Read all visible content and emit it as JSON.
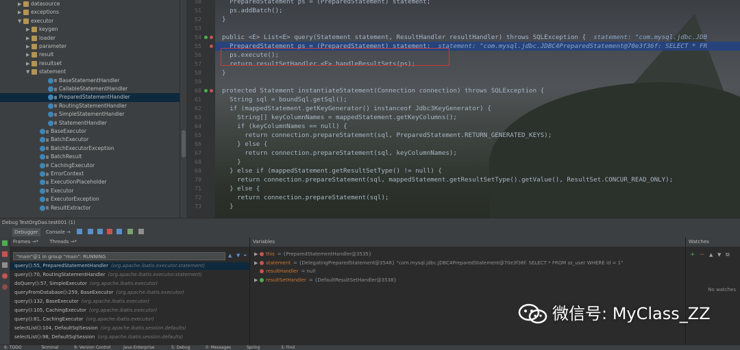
{
  "tree": {
    "items": [
      {
        "label": "datasource",
        "kind": "pkg",
        "depth": 3,
        "arrow": "▶"
      },
      {
        "label": "exceptions",
        "kind": "pkg",
        "depth": 3,
        "arrow": "▶"
      },
      {
        "label": "executor",
        "kind": "pkg",
        "depth": 3,
        "arrow": "▼"
      },
      {
        "label": "keygen",
        "kind": "pkg",
        "depth": 4,
        "arrow": "▶"
      },
      {
        "label": "loader",
        "kind": "pkg",
        "depth": 4,
        "arrow": "▶"
      },
      {
        "label": "parameter",
        "kind": "pkg",
        "depth": 4,
        "arrow": "▶"
      },
      {
        "label": "result",
        "kind": "pkg",
        "depth": 4,
        "arrow": "▶"
      },
      {
        "label": "resultset",
        "kind": "pkg",
        "depth": 4,
        "arrow": "▶"
      },
      {
        "label": "statement",
        "kind": "pkg",
        "depth": 4,
        "arrow": "▼"
      },
      {
        "label": "BaseStatementHandler",
        "kind": "cls",
        "depth": 6
      },
      {
        "label": "CallableStatementHandler",
        "kind": "cls",
        "depth": 6
      },
      {
        "label": "PreparedStatementHandler",
        "kind": "cls",
        "depth": 6,
        "selected": true
      },
      {
        "label": "RoutingStatementHandler",
        "kind": "cls",
        "depth": 6
      },
      {
        "label": "SimpleStatementHandler",
        "kind": "cls",
        "depth": 6
      },
      {
        "label": "StatementHandler",
        "kind": "cls",
        "depth": 6
      },
      {
        "label": "BaseExecutor",
        "kind": "cls",
        "depth": 5
      },
      {
        "label": "BatchExecutor",
        "kind": "cls",
        "depth": 5
      },
      {
        "label": "BatchExecutorException",
        "kind": "cls",
        "depth": 5
      },
      {
        "label": "BatchResult",
        "kind": "cls",
        "depth": 5
      },
      {
        "label": "CachingExecutor",
        "kind": "cls",
        "depth": 5
      },
      {
        "label": "ErrorContext",
        "kind": "cls",
        "depth": 5
      },
      {
        "label": "ExecutionPlaceholder",
        "kind": "cls",
        "depth": 5
      },
      {
        "label": "Executor",
        "kind": "cls",
        "depth": 5
      },
      {
        "label": "ExecutorException",
        "kind": "cls",
        "depth": 5
      },
      {
        "label": "ResultExtractor",
        "kind": "cls",
        "depth": 5
      }
    ]
  },
  "editor": {
    "lines": [
      {
        "num": "50",
        "text": "  PreparedStatement ps = (PreparedStatement) statement;"
      },
      {
        "num": "51",
        "text": "  ps.addBatch();"
      },
      {
        "num": "52",
        "text": "}"
      },
      {
        "num": "53",
        "text": ""
      },
      {
        "num": "54",
        "text": "public <E> List<E> query(Statement statement, ResultHandler resultHandler) throws SQLException {",
        "hint": "  statement: \"com.mysql.jdbc.JDB",
        "marks": "or"
      },
      {
        "num": "55",
        "text": "  PreparedStatement ps = (PreparedStatement) statement;",
        "hint": "  statement: \"com.mysql.jdbc.JDBC4PreparedStatement@70e3f36f: SELECT * FR",
        "current": true,
        "marks": "r"
      },
      {
        "num": "56",
        "text": "  ps.execute();"
      },
      {
        "num": "57",
        "text": "  return resultSetHandler.<E> handleResultSets(ps);"
      },
      {
        "num": "58",
        "text": "}"
      },
      {
        "num": "59",
        "text": ""
      },
      {
        "num": "60",
        "text": "protected Statement instantiateStatement(Connection connection) throws SQLException {",
        "marks": "or"
      },
      {
        "num": "61",
        "text": "  String sql = boundSql.getSql();"
      },
      {
        "num": "62",
        "text": "  if (mappedStatement.getKeyGenerator() instanceof Jdbc3KeyGenerator) {"
      },
      {
        "num": "63",
        "text": "    String[] keyColumnNames = mappedStatement.getKeyColumns();"
      },
      {
        "num": "64",
        "text": "    if (keyColumnNames == null) {"
      },
      {
        "num": "65",
        "text": "      return connection.prepareStatement(sql, PreparedStatement.RETURN_GENERATED_KEYS);"
      },
      {
        "num": "66",
        "text": "    } else {"
      },
      {
        "num": "67",
        "text": "      return connection.prepareStatement(sql, keyColumnNames);"
      },
      {
        "num": "68",
        "text": "    }"
      },
      {
        "num": "69",
        "text": "  } else if (mappedStatement.getResultSetType() != null) {"
      },
      {
        "num": "70",
        "text": "    return connection.prepareStatement(sql, mappedStatement.getResultSetType().getValue(), ResultSet.CONCUR_READ_ONLY);"
      },
      {
        "num": "71",
        "text": "  } else {"
      },
      {
        "num": "72",
        "text": "    return connection.prepareStatement(sql);"
      },
      {
        "num": "73",
        "text": "  }"
      }
    ]
  },
  "debug": {
    "title": "Debug  TestOrgDao.test001 (1)",
    "tabs": {
      "debugger": "Debugger",
      "console": "Console →"
    },
    "frames_tab": "Frames →*",
    "threads_tab": "Threads →*",
    "thread_select": "\"main\"@1 in group \"main\": RUNNING",
    "frames": [
      {
        "method": "query():55, PreparedStatementHandler",
        "pkg": "(org.apache.ibatis.executor.statement)",
        "selected": true
      },
      {
        "method": "query():70, RoutingStatementHandler",
        "pkg": "(org.apache.ibatis.executor.statement)"
      },
      {
        "method": "doQuery():57, SimpleExecutor",
        "pkg": "(org.apache.ibatis.executor)"
      },
      {
        "method": "queryFromDatabase():259, BaseExecutor",
        "pkg": "(org.apache.ibatis.executor)"
      },
      {
        "method": "query():132, BaseExecutor",
        "pkg": "(org.apache.ibatis.executor)"
      },
      {
        "method": "query():105, CachingExecutor",
        "pkg": "(org.apache.ibatis.executor)"
      },
      {
        "method": "query():81, CachingExecutor",
        "pkg": "(org.apache.ibatis.executor)"
      },
      {
        "method": "selectList():104, DefaultSqlSession",
        "pkg": "(org.apache.ibatis.session.defaults)"
      },
      {
        "method": "selectList():98, DefaultSqlSession",
        "pkg": "(org.apache.ibatis.session.defaults)"
      }
    ],
    "variables_title": "Variables",
    "variables": [
      {
        "name": "this",
        "value": "= {PreparedStatementHandler@3535}",
        "dot": "#c75450",
        "tri": "▶"
      },
      {
        "name": "statement",
        "value": "= {DelegatingPreparedStatement@3548} \"com.mysql.jdbc.JDBC4PreparedStatement@70e3f36f: SELECT * FROM zz_user WHERE id = 1\"",
        "dot": "#c75450",
        "tri": "▶"
      },
      {
        "name": "resultHandler",
        "value": "= null",
        "dot": "#c75450",
        "tri": ""
      },
      {
        "name": "resultSetHandler",
        "value": "= {DefaultResultSetHandler@3538}",
        "dot": "#4caf50",
        "tri": "▶"
      }
    ],
    "watches_title": "Watches",
    "no_watches": "No watches"
  },
  "statusbar": {
    "items": [
      "6: TODO",
      "Terminal",
      "9: Version Control",
      "Java Enterprise",
      "5: Debug",
      "0: Messages",
      "Spring",
      "3: Find"
    ]
  },
  "watermark": {
    "text": "微信号: MyClass_ZZ",
    "icon": "wechat-icon"
  },
  "colors": {
    "selection": "#0d293e",
    "current_line": "#214283",
    "breakpoint": "#c75450",
    "highlight_box": "#c73c3c"
  }
}
